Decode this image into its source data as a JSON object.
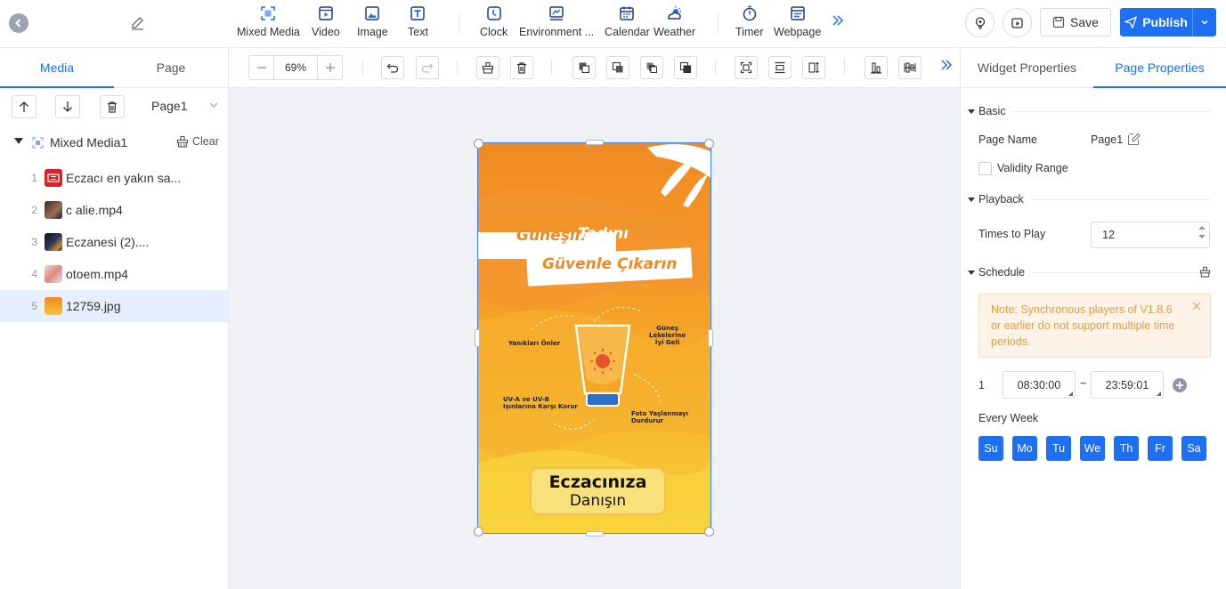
{
  "toolbar": {
    "tools": [
      {
        "label": "Mixed Media",
        "icon": "mixed-media-icon"
      },
      {
        "label": "Video",
        "icon": "video-icon"
      },
      {
        "label": "Image",
        "icon": "image-icon"
      },
      {
        "label": "Text",
        "icon": "text-icon"
      },
      {
        "label": "Clock",
        "icon": "clock-icon"
      },
      {
        "label": "Environment ...",
        "icon": "environment-icon"
      },
      {
        "label": "Calendar",
        "icon": "calendar-icon"
      },
      {
        "label": "Weather",
        "icon": "weather-icon"
      },
      {
        "label": "Timer",
        "icon": "timer-icon"
      },
      {
        "label": "Webpage",
        "icon": "webpage-icon"
      }
    ],
    "save_label": "Save",
    "publish_label": "Publish",
    "accent": "#1e6ff1"
  },
  "left_panel": {
    "tabs": [
      "Media",
      "Page"
    ],
    "active_tab": "Media",
    "page_select": "Page1",
    "tree_root": "Mixed Media1",
    "clear_label": "Clear",
    "items": [
      {
        "index": "1",
        "name": "Eczacı en yakın sa...",
        "thumb_color": "#d8232a"
      },
      {
        "index": "2",
        "name": "c     alie.mp4",
        "thumb_color": "#6b4a3a"
      },
      {
        "index": "3",
        "name": "       Eczanesi (2)....",
        "thumb_color": "#1d2230"
      },
      {
        "index": "4",
        "name": "          otoem.mp4",
        "thumb_color": "#e6b6b0"
      },
      {
        "index": "5",
        "name": "12759.jpg",
        "thumb_color": "#f5a623"
      }
    ],
    "selected_index": "5"
  },
  "canvas": {
    "zoom": "69%",
    "poster": {
      "headline_1a": "Güneşin",
      "headline_1b": "Tadını",
      "headline_2": "Güvenle Çıkarın",
      "label_left": "Yanıkları Önler",
      "label_right_1": "Güneş",
      "label_right_2": "Lekelerine",
      "label_right_3": "İyi Geli",
      "label_bl_1": "UV-A ve UV-B",
      "label_bl_2": "Işınlarına Karşı Korur",
      "label_br_1": "Foto Yaşlanmayı",
      "label_br_2": "Durdurur",
      "cta_1": "Eczacınıza",
      "cta_2": "Danışın"
    }
  },
  "right_panel": {
    "tabs": [
      "Widget Properties",
      "Page Properties"
    ],
    "active_tab": "Page Properties",
    "sections": {
      "basic": "Basic",
      "playback": "Playback",
      "schedule": "Schedule"
    },
    "page_name_label": "Page Name",
    "page_name_value": "Page1",
    "validity_label": "Validity Range",
    "times_label": "Times to Play",
    "times_value": "12",
    "note": "Note: Synchronous players of V1.8.6 or earlier do not support multiple time periods.",
    "time_index": "1",
    "time_start": "08:30:00",
    "time_sep": "~",
    "time_end": "23:59:01",
    "every_week_label": "Every Week",
    "days": [
      "Su",
      "Mo",
      "Tu",
      "We",
      "Th",
      "Fr",
      "Sa"
    ]
  }
}
